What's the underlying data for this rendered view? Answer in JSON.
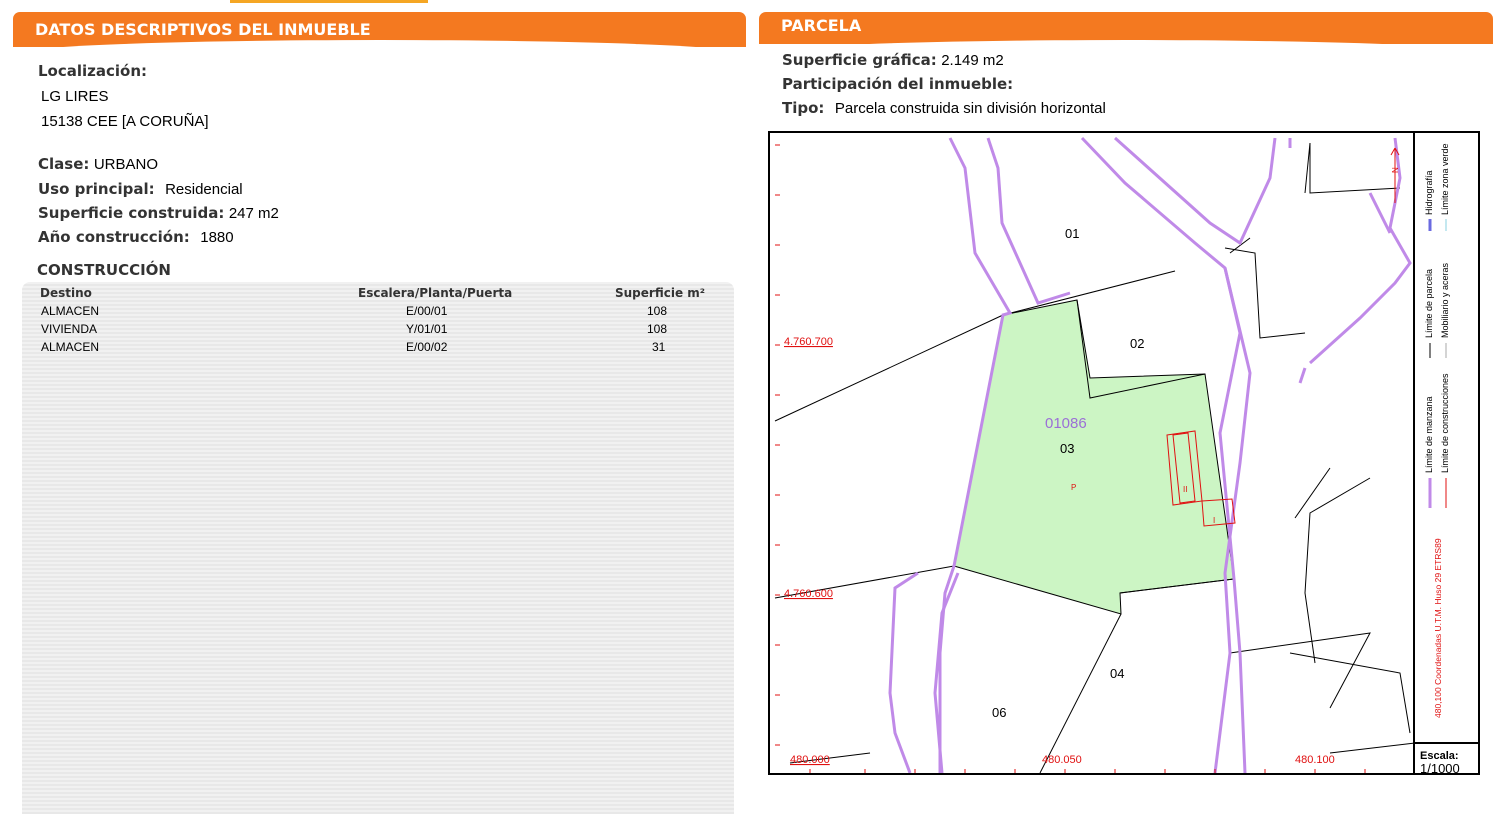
{
  "left": {
    "header": "DATOS DESCRIPTIVOS DEL INMUEBLE",
    "localizacion_label": "Localización:",
    "address_line1": "LG LIRES",
    "address_line2": "15138 CEE [A CORUÑA]",
    "clase_label": "Clase:",
    "clase_value": "URBANO",
    "uso_label": "Uso principal:",
    "uso_value": "Residencial",
    "superficie_label": "Superficie construida:",
    "superficie_value": "247 m2",
    "anio_label": "Año construcción:",
    "anio_value": "1880",
    "construccion_title": "CONSTRUCCIÓN",
    "table": {
      "headers": [
        "Destino",
        "Escalera/Planta/Puerta",
        "Superficie m²"
      ],
      "rows": [
        [
          "ALMACEN",
          "E/00/01",
          "108"
        ],
        [
          "VIVIENDA",
          "Y/01/01",
          "108"
        ],
        [
          "ALMACEN",
          "E/00/02",
          "31"
        ]
      ]
    }
  },
  "right": {
    "header": "PARCELA",
    "sup_grafica_label": "Superficie gráfica:",
    "sup_grafica_value": "2.149 m2",
    "participacion_label": "Participación del inmueble:",
    "tipo_label": "Tipo:",
    "tipo_value": "Parcela construida sin división horizontal"
  },
  "map": {
    "parcel_id": "01086",
    "labels": {
      "p01": "01",
      "p02": "02",
      "p03": "03",
      "p04": "04",
      "p06": "06",
      "p_letter": "P",
      "b_ii": "II",
      "b_i": "I"
    },
    "coords": {
      "y1": "4.760.700",
      "y2": "4.760.600",
      "x1": "480.000",
      "x2": "480.050",
      "x3": "480.100"
    },
    "legend": {
      "manzana": "Límite de manzana",
      "construcciones": "Límite de construcciones",
      "parcela": "Límite de parcela",
      "mobiliario": "Mobiliario y aceras",
      "hidrografia": "Hidrografía",
      "zona_verde": "Límite zona verde",
      "coordinates": "480,100 Coordenadas U.T.M. Huso 29 ETRS89",
      "escala_label": "Escala:",
      "escala_value": "1/1000",
      "north": "N"
    },
    "colors": {
      "parcel_fill": "#ccf5c4",
      "manzana": "#c08ae8",
      "construccion": "#e01010",
      "parcel_label": "#9b6fd6"
    }
  }
}
